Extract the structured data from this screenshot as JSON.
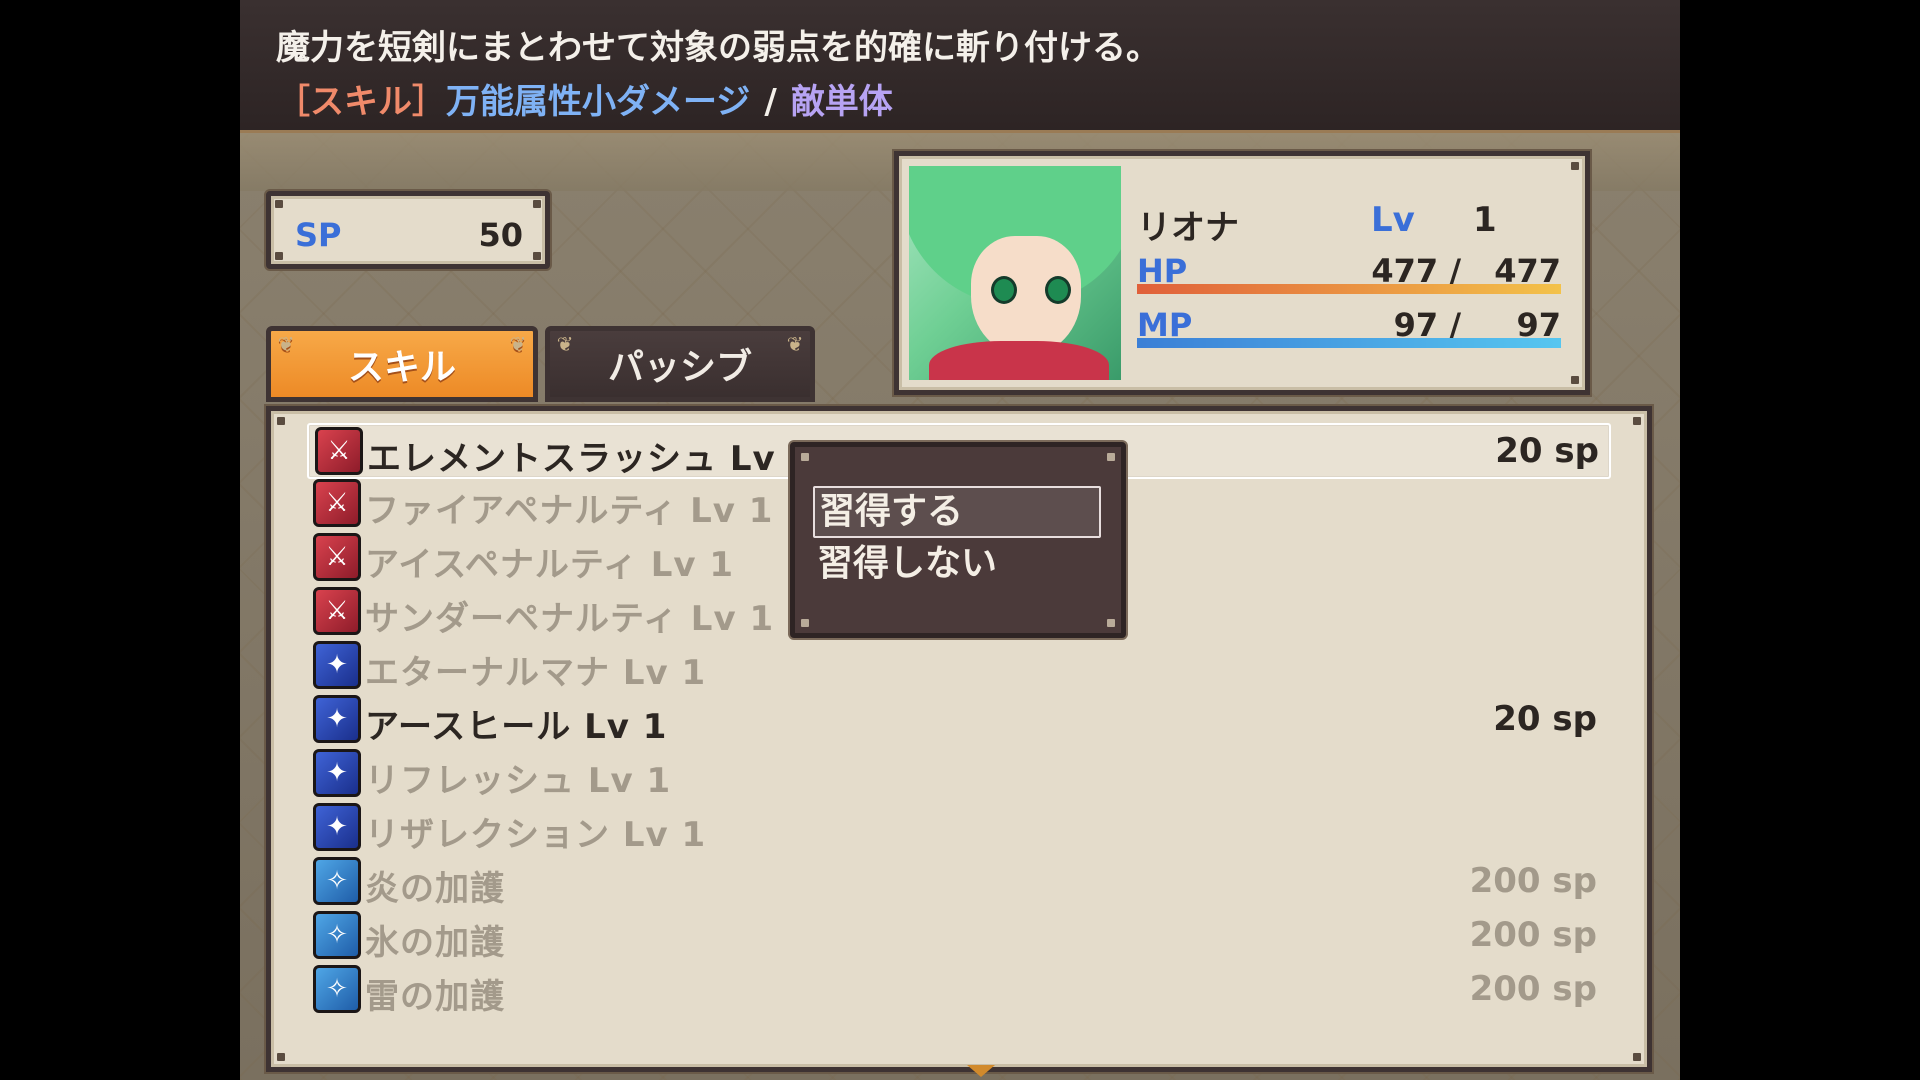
{
  "help": {
    "description": "魔力を短剣にまとわせて対象の弱点を的確に斬り付ける。",
    "tag_skill": "［スキル］",
    "tag_attribute": "万能属性小ダメージ",
    "tag_separator": "/",
    "tag_target": "敵単体"
  },
  "sp": {
    "label": "SP",
    "value": "50"
  },
  "tabs": [
    {
      "label": "スキル",
      "active": true
    },
    {
      "label": "パッシブ",
      "active": false
    }
  ],
  "actor": {
    "name": "リオナ",
    "level_label": "Lv",
    "level": "1",
    "hp_label": "HP",
    "hp": "477",
    "hp_max": "477",
    "hp_ratio": 1.0,
    "mp_label": "MP",
    "mp": "97",
    "mp_max": "97",
    "mp_ratio": 1.0,
    "hp_text": "477 /",
    "mp_text": "97 /"
  },
  "skills": [
    {
      "name": "エレメントスラッシュ Lv",
      "cost": "20 sp",
      "icon": "red-sword-icon",
      "enabled": true,
      "selected": true
    },
    {
      "name": "ファイアペナルティ Lv 1",
      "cost": "",
      "icon": "red-sword-icon",
      "enabled": false
    },
    {
      "name": "アイスペナルティ Lv 1",
      "cost": "",
      "icon": "red-sword-icon",
      "enabled": false
    },
    {
      "name": "サンダーペナルティ Lv 1",
      "cost": "",
      "icon": "red-sword-icon",
      "enabled": false
    },
    {
      "name": "エターナルマナ Lv 1",
      "cost": "",
      "icon": "blue-mage-icon",
      "enabled": false
    },
    {
      "name": "アースヒール Lv 1",
      "cost": "20 sp",
      "icon": "blue-mage-icon",
      "enabled": true
    },
    {
      "name": "リフレッシュ Lv 1",
      "cost": "",
      "icon": "blue-mage-icon",
      "enabled": false
    },
    {
      "name": "リザレクション Lv 1",
      "cost": "",
      "icon": "blue-mage-icon",
      "enabled": false
    },
    {
      "name": "炎の加護",
      "cost": "200 sp",
      "icon": "blessing-icon",
      "enabled": false
    },
    {
      "name": "氷の加護",
      "cost": "200 sp",
      "icon": "blessing-icon",
      "enabled": false
    },
    {
      "name": "雷の加護",
      "cost": "200 sp",
      "icon": "blessing-icon",
      "enabled": false
    }
  ],
  "learn_menu": {
    "options": [
      "習得する",
      "習得しない"
    ],
    "selected_index": 0
  }
}
